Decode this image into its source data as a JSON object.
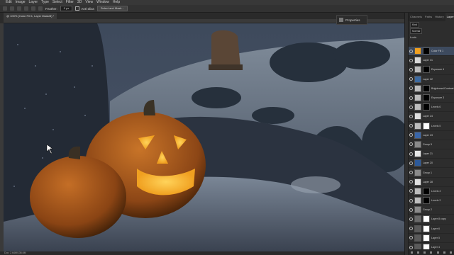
{
  "menu": [
    "Edit",
    "Image",
    "Layer",
    "Type",
    "Select",
    "Filter",
    "3D",
    "View",
    "Window",
    "Help"
  ],
  "options": {
    "feather_label": "Feather:",
    "feather_value": "0 px",
    "antialias_label": "Anti-alias",
    "select_mask_label": "Select and Mask..."
  },
  "document": {
    "tab_title": "@ 100% (Color Fill 1, Layer Mask/8) *",
    "status": "Doc: 2.64M/136.6M"
  },
  "properties_label": "Properties",
  "panel": {
    "tabs": [
      "Channels",
      "Paths",
      "History",
      "Layers"
    ],
    "active_tab": "Layers",
    "kind_label": "Kind",
    "blend_mode": "Normal",
    "lock_label": "Lock:"
  },
  "layers": [
    {
      "name": "Color Fill 1",
      "thumb": "#f0a020",
      "mask": "#000000",
      "selected": true
    },
    {
      "name": "Layer 31",
      "thumb": "#d8d8d8",
      "mask": null,
      "selected": false
    },
    {
      "name": "Exposure 4",
      "thumb": "#bdbdbd",
      "mask": "#000000",
      "selected": false
    },
    {
      "name": "Layer 22",
      "thumb": "#3d6aa0",
      "mask": null,
      "selected": false
    },
    {
      "name": "Brightness/Contrast 4",
      "thumb": "#bdbdbd",
      "mask": "#000000",
      "selected": false
    },
    {
      "name": "Exposure 3",
      "thumb": "#bdbdbd",
      "mask": "#000000",
      "selected": false
    },
    {
      "name": "Levels 6",
      "thumb": "#bdbdbd",
      "mask": "#000000",
      "selected": false
    },
    {
      "name": "Layer 24",
      "thumb": "#e0e0e0",
      "mask": null,
      "selected": false
    },
    {
      "name": "Levels 5",
      "thumb": "#bdbdbd",
      "mask": "#ffffff",
      "selected": false
    },
    {
      "name": "Layer 23",
      "thumb": "#3a66a8",
      "mask": null,
      "selected": false
    },
    {
      "name": "Group 5",
      "thumb": "#8a8a8a",
      "mask": null,
      "selected": false
    },
    {
      "name": "Layer 21",
      "thumb": "#e8e8e8",
      "mask": null,
      "selected": false
    },
    {
      "name": "Layer 20",
      "thumb": "#2d5a9a",
      "mask": null,
      "selected": false
    },
    {
      "name": "Group 1",
      "thumb": "#8a8a8a",
      "mask": null,
      "selected": false
    },
    {
      "name": "Layer 28",
      "thumb": "#e0e0e0",
      "mask": null,
      "selected": false
    },
    {
      "name": "Levels 4",
      "thumb": "#bdbdbd",
      "mask": "#000000",
      "selected": false
    },
    {
      "name": "Levels 3",
      "thumb": "#bdbdbd",
      "mask": "#000000",
      "selected": false
    },
    {
      "name": "Group 2",
      "thumb": "#8a8a8a",
      "mask": null,
      "selected": false
    },
    {
      "name": "Layer 8 copy",
      "thumb": "#6a6a6a",
      "mask": "#ffffff",
      "selected": false
    },
    {
      "name": "Layer 6",
      "thumb": "#5a5a5a",
      "mask": "#ffffff",
      "selected": false
    },
    {
      "name": "Layer 5",
      "thumb": "#5a5a5a",
      "mask": "#ffffff",
      "selected": false
    },
    {
      "name": "Layer 4",
      "thumb": "#5a5a5a",
      "mask": "#ffffff",
      "selected": false
    }
  ]
}
